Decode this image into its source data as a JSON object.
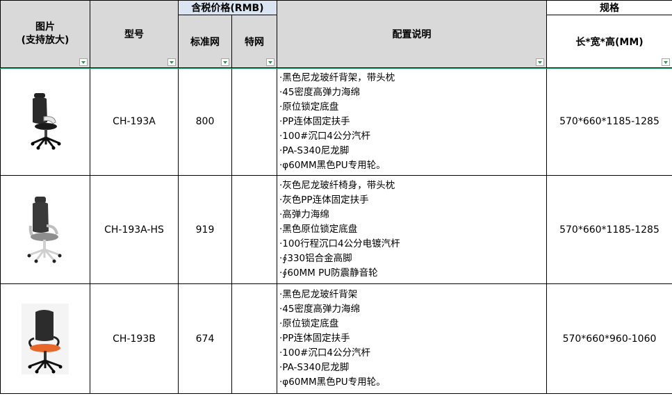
{
  "headers": {
    "image_col": "图片\n(支持放大)",
    "model_col": "型号",
    "price_group": "含税价格(RMB)",
    "standard_col": "标准网",
    "special_col": "特网",
    "config_col": "配置说明",
    "spec_group": "规格",
    "dimension_col": "长*宽*高(MM)"
  },
  "products": [
    {
      "model": "CH-193A",
      "standard_price": "800",
      "special_price": "",
      "config": [
        "·黑色尼龙玻纤背架，带头枕",
        "·45密度高弹力海绵",
        "·原位锁定底盘",
        "·PP连体固定扶手",
        "·100#沉口4公分汽杆",
        "·PA-S340尼龙脚",
        "·φ60MM黑色PU专用轮。"
      ],
      "dimensions": "570*660*1185-1285",
      "image_icon": "office-chair-black-headrest"
    },
    {
      "model": "CH-193A-HS",
      "standard_price": "919",
      "special_price": "",
      "config": [
        "·灰色尼龙玻纤椅身，带头枕",
        "·灰色PP连体固定扶手",
        "·高弹力海绵",
        "·黑色原位锁定底盘",
        "·100行程沉口4公分电镀汽杆",
        "·∮330铝合金高脚",
        "·∮60MM PU防震静音轮"
      ],
      "dimensions": "570*660*1185-1285",
      "image_icon": "office-chair-grey-headrest"
    },
    {
      "model": "CH-193B",
      "standard_price": "674",
      "special_price": "",
      "config": [
        "·黑色尼龙玻纤背架",
        "·45密度高弹力海绵",
        "·原位锁定底盘",
        "·PP连体固定扶手",
        "·100#沉口4公分汽杆",
        "·PA-S340尼龙脚",
        "·φ60MM黑色PU专用轮。"
      ],
      "dimensions": "570*660*960-1060",
      "image_icon": "office-chair-orange-seat"
    }
  ],
  "colors": {
    "header_bg": "#d9d9d9",
    "group_header_bg": "#dbe5f1",
    "filter_arrow": "#3c8c5a",
    "frozen_line": "#21a366"
  }
}
